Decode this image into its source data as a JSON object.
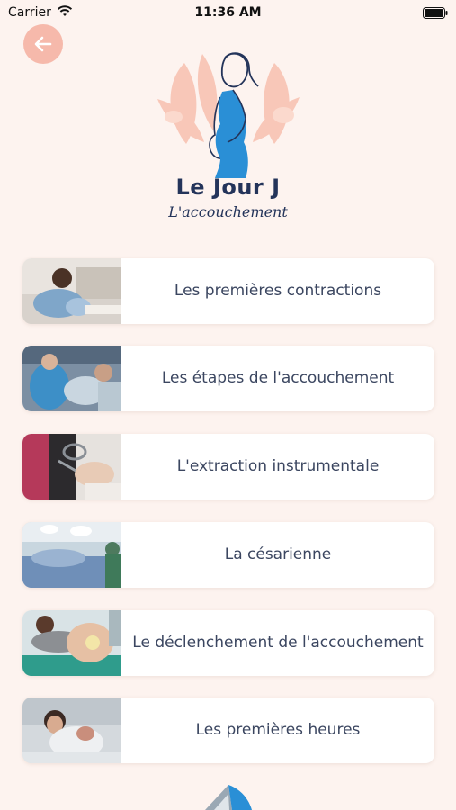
{
  "status_bar": {
    "carrier": "Carrier",
    "time": "11:36 AM"
  },
  "header": {
    "back_icon": "arrow-left-icon",
    "logo": {
      "title": "Le Jour J",
      "subtitle": "L'accouchement"
    }
  },
  "menu": {
    "items": [
      {
        "label": "Les premières contractions",
        "thumb_icon": "photo-pregnant-woman-sofa"
      },
      {
        "label": "Les étapes de l'accouchement",
        "thumb_icon": "photo-delivery-room"
      },
      {
        "label": "L'extraction instrumentale",
        "thumb_icon": "photo-instruments"
      },
      {
        "label": "La césarienne",
        "thumb_icon": "photo-operating-room"
      },
      {
        "label": "Le déclenchement de l'accouchement",
        "thumb_icon": "photo-monitoring-belly"
      },
      {
        "label": "Les premières heures",
        "thumb_icon": "photo-mother-newborn"
      }
    ]
  },
  "colors": {
    "background": "#fdf3ef",
    "accent": "#f6b9ab",
    "title": "#24345a",
    "dress": "#2a8fd6",
    "card": "#ffffff"
  }
}
